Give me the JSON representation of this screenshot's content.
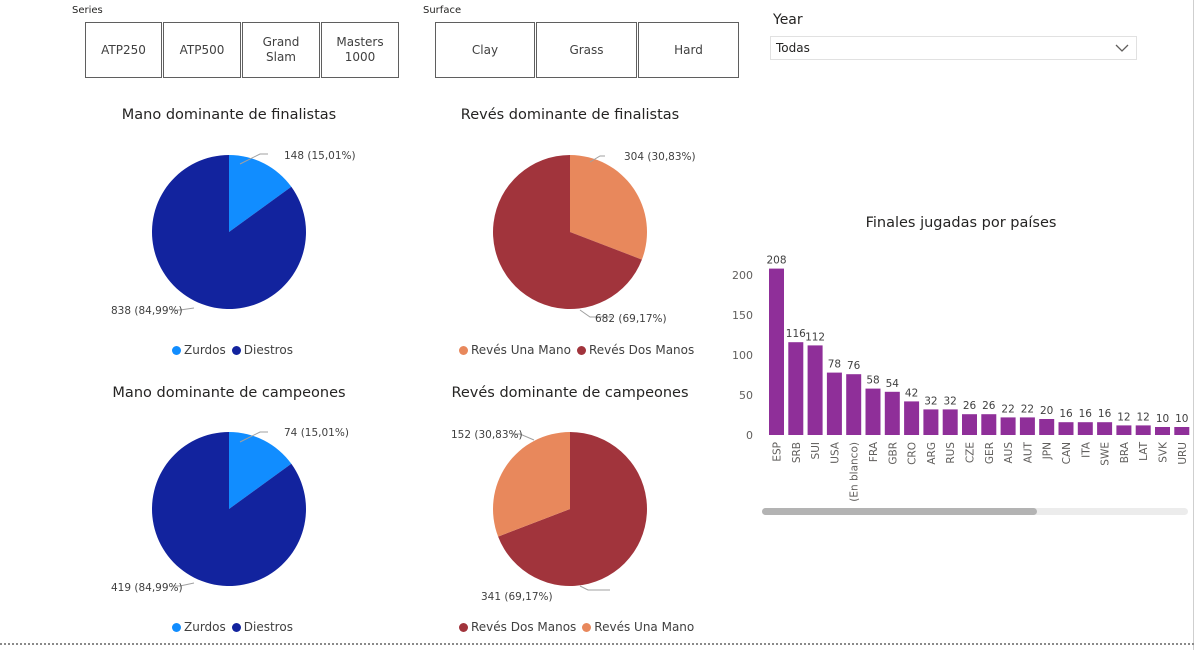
{
  "series_slicer": {
    "title": "Series",
    "options": [
      "ATP250",
      "ATP500",
      "Grand\nSlam",
      "Masters\n1000"
    ]
  },
  "surface_slicer": {
    "title": "Surface",
    "options": [
      "Clay",
      "Grass",
      "Hard"
    ]
  },
  "year_slicer": {
    "title": "Year",
    "value": "Todas"
  },
  "colors": {
    "light_blue": "#118DFF",
    "dark_blue": "#12239E",
    "light_orange": "#E8885C",
    "dark_red": "#A1343C",
    "purple": "#8F2F99"
  },
  "pie_finalists_hand": {
    "title": "Mano dominante de finalistas",
    "slices": [
      {
        "name": "Zurdos",
        "value": 148,
        "label": "148 (15,01%)",
        "color": "#118DFF"
      },
      {
        "name": "Diestros",
        "value": 838,
        "label": "838 (84,99%)",
        "color": "#12239E"
      }
    ],
    "legend": [
      {
        "name": "Zurdos",
        "color": "#118DFF"
      },
      {
        "name": "Diestros",
        "color": "#12239E"
      }
    ]
  },
  "pie_finalists_backhand": {
    "title": "Revés dominante de finalistas",
    "slices": [
      {
        "name": "Revés Una Mano",
        "value": 304,
        "label": "304 (30,83%)",
        "color": "#E8885C"
      },
      {
        "name": "Revés Dos Manos",
        "value": 682,
        "label": "682 (69,17%)",
        "color": "#A1343C"
      }
    ],
    "legend": [
      {
        "name": "Revés Una Mano",
        "color": "#E8885C"
      },
      {
        "name": "Revés Dos Manos",
        "color": "#A1343C"
      }
    ]
  },
  "pie_champions_hand": {
    "title": "Mano dominante de campeones",
    "slices": [
      {
        "name": "Zurdos",
        "value": 74,
        "label": "74 (15,01%)",
        "color": "#118DFF"
      },
      {
        "name": "Diestros",
        "value": 419,
        "label": "419 (84,99%)",
        "color": "#12239E"
      }
    ],
    "legend": [
      {
        "name": "Zurdos",
        "color": "#118DFF"
      },
      {
        "name": "Diestros",
        "color": "#12239E"
      }
    ]
  },
  "pie_champions_backhand": {
    "title": "Revés dominante de campeones",
    "slices": [
      {
        "name": "Revés Dos Manos",
        "value": 341,
        "label": "341 (69,17%)",
        "color": "#A1343C"
      },
      {
        "name": "Revés Una Mano",
        "value": 152,
        "label": "152 (30,83%)",
        "color": "#E8885C"
      }
    ],
    "legend": [
      {
        "name": "Revés Dos Manos",
        "color": "#A1343C"
      },
      {
        "name": "Revés Una Mano",
        "color": "#E8885C"
      }
    ]
  },
  "chart_data": {
    "type": "bar",
    "title": "Finales jugadas por países",
    "categories": [
      "ESP",
      "SRB",
      "SUI",
      "USA",
      "(En blanco)",
      "FRA",
      "GBR",
      "CRO",
      "ARG",
      "RUS",
      "CZE",
      "GER",
      "AUS",
      "AUT",
      "JPN",
      "CAN",
      "ITA",
      "SWE",
      "BRA",
      "LAT",
      "SVK",
      "URU"
    ],
    "values": [
      208,
      116,
      112,
      78,
      76,
      58,
      54,
      42,
      32,
      32,
      26,
      26,
      22,
      22,
      20,
      16,
      16,
      16,
      12,
      12,
      10,
      10
    ],
    "yticks": [
      0,
      50,
      100,
      150,
      200
    ],
    "ylim": [
      0,
      208
    ],
    "color": "#8F2F99",
    "xlabel": "",
    "ylabel": "",
    "grid": false
  }
}
